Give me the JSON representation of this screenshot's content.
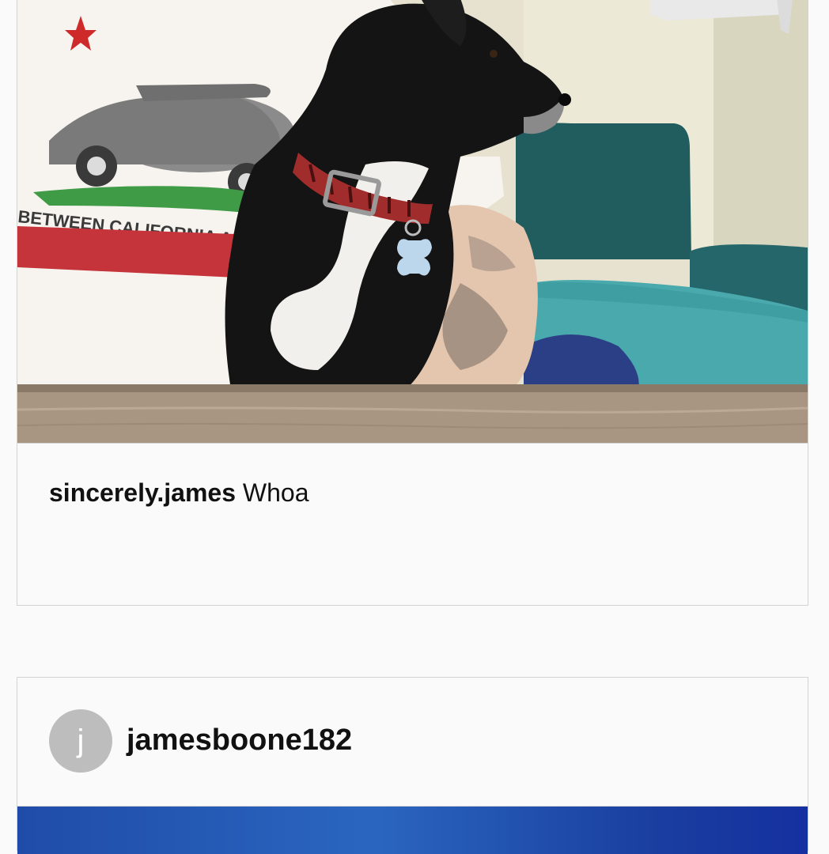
{
  "feed": {
    "posts": [
      {
        "image_alt": "Person in white t-shirt holding a black and white dog with a red plaid collar",
        "caption": {
          "username": "sincerely.james",
          "text": "Whoa"
        }
      },
      {
        "header": {
          "avatar_initial": "j",
          "username": "jamesboone182"
        }
      }
    ]
  },
  "colors": {
    "background": "#fafafa",
    "border": "#d3d3d3",
    "avatar": "#bdbdbd"
  }
}
